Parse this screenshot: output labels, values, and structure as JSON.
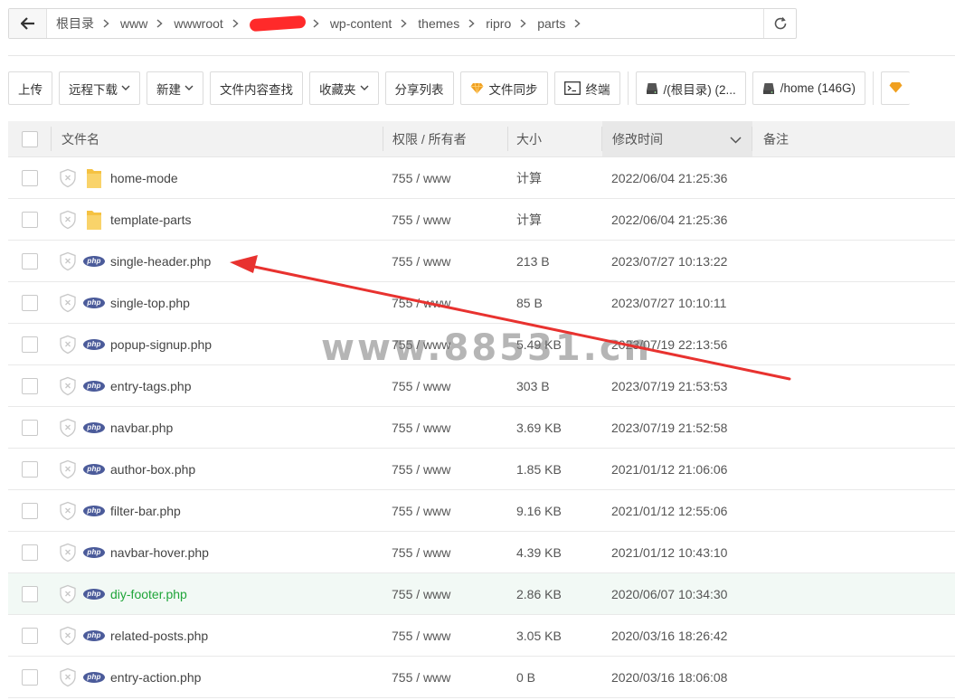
{
  "breadcrumb": {
    "items": [
      "根目录",
      "www",
      "wwwroot",
      "wp-content",
      "themes",
      "ripro",
      "parts"
    ]
  },
  "toolbar": {
    "upload": "上传",
    "remote_download": "远程下载",
    "new": "新建",
    "content_search": "文件内容查找",
    "favorites": "收藏夹",
    "share_list": "分享列表",
    "file_sync": "文件同步",
    "terminal": "终端",
    "disk_root": "/(根目录) (2...",
    "disk_home": "/home (146G)"
  },
  "table": {
    "headers": {
      "name": "文件名",
      "perm": "权限 / 所有者",
      "size": "大小",
      "mtime": "修改时间",
      "note": "备注"
    },
    "rows": [
      {
        "type": "folder",
        "name": "home-mode",
        "perm": "755 / www",
        "size": "计算",
        "mtime": "2022/06/04 21:25:36"
      },
      {
        "type": "folder",
        "name": "template-parts",
        "perm": "755 / www",
        "size": "计算",
        "mtime": "2022/06/04 21:25:36"
      },
      {
        "type": "php",
        "name": "single-header.php",
        "perm": "755 / www",
        "size": "213 B",
        "mtime": "2023/07/27 10:13:22"
      },
      {
        "type": "php",
        "name": "single-top.php",
        "perm": "755 / www",
        "size": "85 B",
        "mtime": "2023/07/27 10:10:11"
      },
      {
        "type": "php",
        "name": "popup-signup.php",
        "perm": "755 / www",
        "size": "5.49 KB",
        "mtime": "2023/07/19 22:13:56"
      },
      {
        "type": "php",
        "name": "entry-tags.php",
        "perm": "755 / www",
        "size": "303 B",
        "mtime": "2023/07/19 21:53:53"
      },
      {
        "type": "php",
        "name": "navbar.php",
        "perm": "755 / www",
        "size": "3.69 KB",
        "mtime": "2023/07/19 21:52:58"
      },
      {
        "type": "php",
        "name": "author-box.php",
        "perm": "755 / www",
        "size": "1.85 KB",
        "mtime": "2021/01/12 21:06:06"
      },
      {
        "type": "php",
        "name": "filter-bar.php",
        "perm": "755 / www",
        "size": "9.16 KB",
        "mtime": "2021/01/12 12:55:06"
      },
      {
        "type": "php",
        "name": "navbar-hover.php",
        "perm": "755 / www",
        "size": "4.39 KB",
        "mtime": "2021/01/12 10:43:10"
      },
      {
        "type": "php",
        "name": "diy-footer.php",
        "perm": "755 / www",
        "size": "2.86 KB",
        "mtime": "2020/06/07 10:34:30",
        "highlighted": true
      },
      {
        "type": "php",
        "name": "related-posts.php",
        "perm": "755 / www",
        "size": "3.05 KB",
        "mtime": "2020/03/16 18:26:42"
      },
      {
        "type": "php",
        "name": "entry-action.php",
        "perm": "755 / www",
        "size": "0 B",
        "mtime": "2020/03/16 18:06:08"
      }
    ]
  },
  "php_badge": "php",
  "watermark": "www.88531.cn",
  "colors": {
    "accent_green": "#20a53a",
    "php_badge": "#4b5b9a",
    "folder": "#f5c242",
    "annotation_red": "#e8322f"
  }
}
